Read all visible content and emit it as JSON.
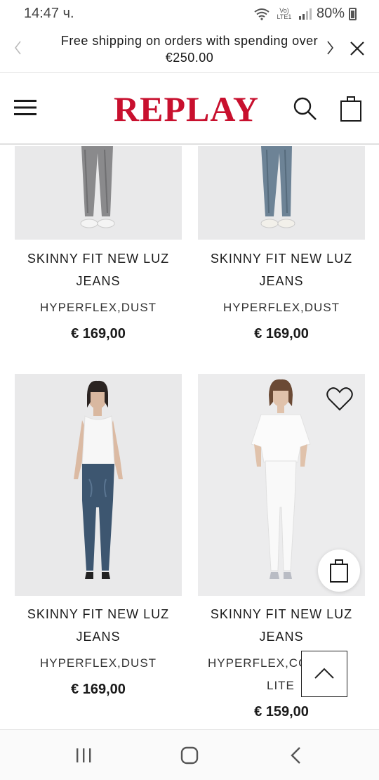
{
  "status_bar": {
    "time": "14:47 ч.",
    "network": "Vo) LTE1",
    "battery": "80%"
  },
  "promo": {
    "text": "Free shipping on orders with spending over €250.00"
  },
  "header": {
    "logo": "REPLAY"
  },
  "icons": {
    "menu": "hamburger-menu-icon",
    "search": "search-icon",
    "bag": "shopping-bag-icon",
    "heart": "heart-icon",
    "scroll_top": "chevron-up-icon"
  },
  "colors": {
    "brand_red": "#c8102e",
    "image_bg": "#e9e9ea"
  },
  "products": [
    {
      "name_line1": "SKINNY FIT NEW LUZ",
      "name_line2": "JEANS",
      "color": "HYPERFLEX,DUST",
      "color_line2": "",
      "price": "€ 169,00"
    },
    {
      "name_line1": "SKINNY FIT NEW LUZ",
      "name_line2": "JEANS",
      "color": "HYPERFLEX,DUST",
      "color_line2": "",
      "price": "€ 169,00"
    },
    {
      "name_line1": "SKINNY FIT NEW LUZ",
      "name_line2": "JEANS",
      "color": "HYPERFLEX,DUST",
      "color_line2": "",
      "price": "€ 169,00"
    },
    {
      "name_line1": "SKINNY FIT NEW LUZ",
      "name_line2": "JEANS",
      "color": "HYPERFLEX,CO",
      "color_line2": "LITE",
      "price": "€ 159,00"
    }
  ]
}
